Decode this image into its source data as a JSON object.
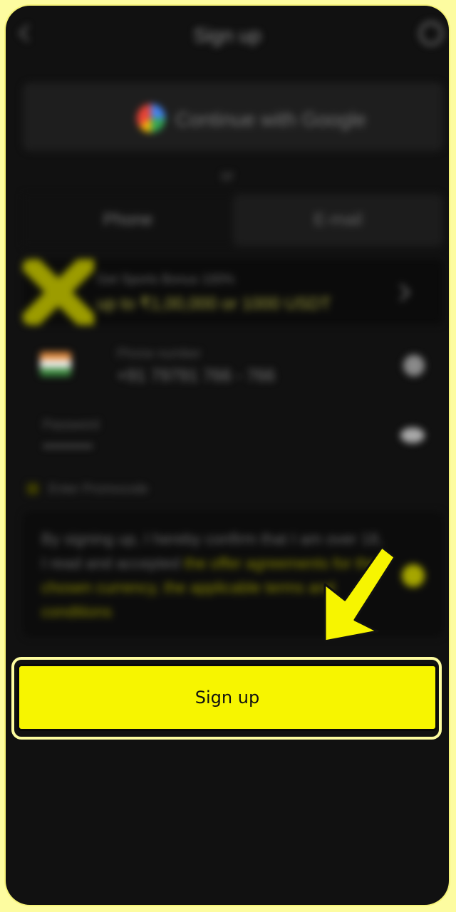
{
  "header": {
    "title": "Sign up"
  },
  "google": {
    "label": "Continue with Google"
  },
  "divider": {
    "text": "or"
  },
  "tabs": [
    {
      "label": "Phone"
    },
    {
      "label": "E-mail"
    }
  ],
  "bonus": {
    "line1": "Get Sports Bonus 100%",
    "line2": "up to ₹1,00,000 or 1000 USDT"
  },
  "phone": {
    "label": "Phone number",
    "value": "+91 79791 766 - 766"
  },
  "password": {
    "label": "Password",
    "value": "••••••••••"
  },
  "promo": {
    "label": "Enter Promocode"
  },
  "terms": {
    "text": "By signing up, I hereby confirm that I am over 18, I read and accepted ",
    "link": "the offer agreements for the chosen currency, the applicable terms and conditions"
  },
  "signup": {
    "label": "Sign up"
  },
  "colors": {
    "accent": "#f7f500",
    "background": "#111111",
    "frame": "#fdfca0"
  },
  "icons": {
    "back": "back-chevron-icon",
    "support": "support-icon",
    "google": "google-logo-icon",
    "flag": "india-flag-icon",
    "clear": "clear-icon",
    "eye": "eye-icon",
    "arrow": "pointer-arrow-icon"
  }
}
